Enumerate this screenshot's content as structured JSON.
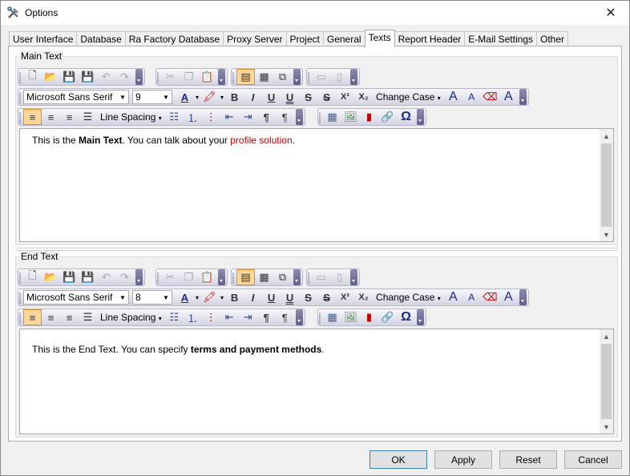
{
  "window": {
    "title": "Options",
    "close_glyph": "✕"
  },
  "tabs": [
    {
      "label": "User Interface"
    },
    {
      "label": "Database"
    },
    {
      "label": "Ra Factory Database"
    },
    {
      "label": "Proxy Server"
    },
    {
      "label": "Project"
    },
    {
      "label": "General"
    },
    {
      "label": "Texts",
      "active": true
    },
    {
      "label": "Report Header"
    },
    {
      "label": "E-Mail Settings"
    },
    {
      "label": "Other"
    }
  ],
  "main_text": {
    "label": "Main Text",
    "font": "Microsoft Sans Serif",
    "size": "9",
    "content_prefix": "This is the ",
    "content_bold": "Main Text",
    "content_mid": ". You can talk about your ",
    "content_red": "profile solution",
    "content_end": "."
  },
  "end_text": {
    "label": "End Text",
    "font": "Microsoft Sans Serif",
    "size": "8",
    "content_prefix": "This is the End Text. You can specify ",
    "content_bold": "terms and payment methods",
    "content_end": "."
  },
  "toolbar": {
    "change_case": "Change Case",
    "line_spacing": "Line Spacing",
    "bold": "B",
    "italic": "I",
    "underline": "U",
    "underline2": "U",
    "strike": "S",
    "strike2": "S",
    "superscript": "X²",
    "subscript": "X₂",
    "grow_font": "A",
    "shrink_font": "A",
    "font_color": "A",
    "paragraph": "¶",
    "symbol": "Ω"
  },
  "buttons": {
    "ok": "OK",
    "apply": "Apply",
    "reset": "Reset",
    "cancel": "Cancel"
  },
  "colors": {
    "accent_red": "#c00000",
    "pressed": "#fbd79a"
  }
}
